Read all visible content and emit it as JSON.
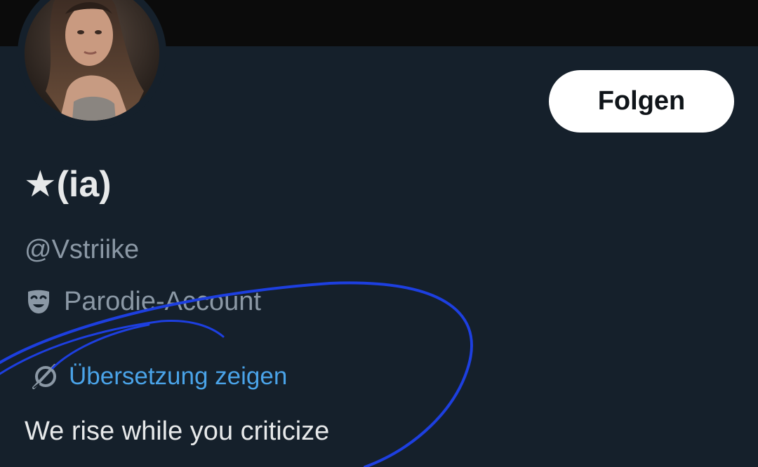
{
  "profile": {
    "display_name": "★(ia)",
    "handle": "@Vstriike",
    "parody_label": "Parodie-Account",
    "parody_icon": "theater-mask-icon",
    "translate_label": "Übersetzung zeigen",
    "translate_icon": "translate-icon",
    "bio": "We rise while you criticize"
  },
  "actions": {
    "follow_label": "Folgen"
  },
  "colors": {
    "background": "#15202b",
    "banner": "#0b0b0b",
    "link": "#4aa3e8",
    "secondary_text": "#8b98a5",
    "primary_text": "#e7e9ea",
    "annotation_ink": "#1d3fe0"
  }
}
